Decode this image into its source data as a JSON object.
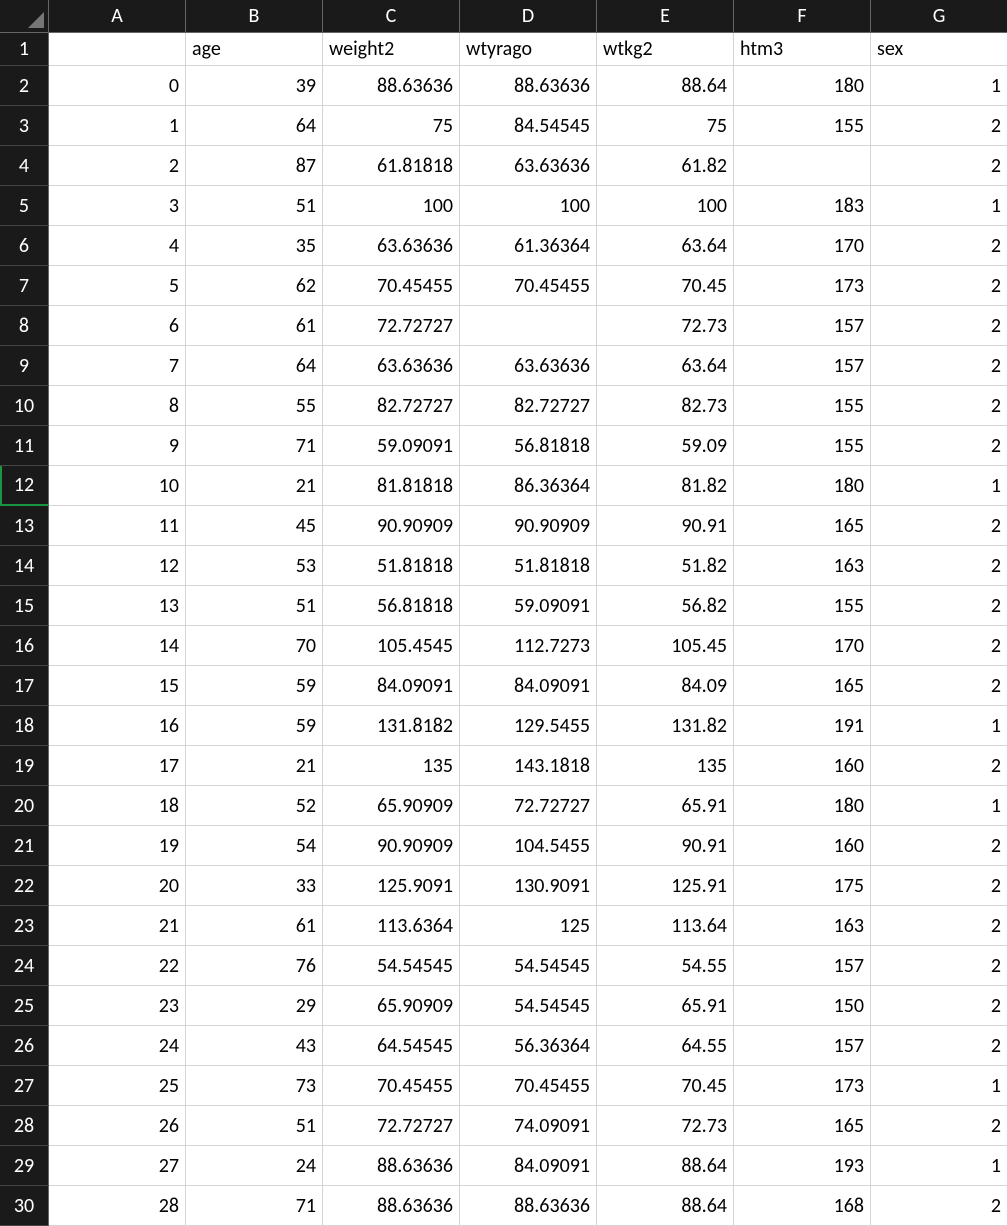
{
  "columns": [
    "A",
    "B",
    "C",
    "D",
    "E",
    "F",
    "G"
  ],
  "headers": [
    "",
    "age",
    "weight2",
    "wtyrago",
    "wtkg2",
    "htm3",
    "sex"
  ],
  "selectedRow": 12,
  "rows": [
    {
      "rn": "1",
      "A": "",
      "B": "age",
      "C": "weight2",
      "D": "wtyrago",
      "E": "wtkg2",
      "F": "htm3",
      "G": "sex",
      "text": true
    },
    {
      "rn": "2",
      "A": "0",
      "B": "39",
      "C": "88.63636",
      "D": "88.63636",
      "E": "88.64",
      "F": "180",
      "G": "1"
    },
    {
      "rn": "3",
      "A": "1",
      "B": "64",
      "C": "75",
      "D": "84.54545",
      "E": "75",
      "F": "155",
      "G": "2"
    },
    {
      "rn": "4",
      "A": "2",
      "B": "87",
      "C": "61.81818",
      "D": "63.63636",
      "E": "61.82",
      "F": "",
      "G": "2"
    },
    {
      "rn": "5",
      "A": "3",
      "B": "51",
      "C": "100",
      "D": "100",
      "E": "100",
      "F": "183",
      "G": "1"
    },
    {
      "rn": "6",
      "A": "4",
      "B": "35",
      "C": "63.63636",
      "D": "61.36364",
      "E": "63.64",
      "F": "170",
      "G": "2"
    },
    {
      "rn": "7",
      "A": "5",
      "B": "62",
      "C": "70.45455",
      "D": "70.45455",
      "E": "70.45",
      "F": "173",
      "G": "2"
    },
    {
      "rn": "8",
      "A": "6",
      "B": "61",
      "C": "72.72727",
      "D": "",
      "E": "72.73",
      "F": "157",
      "G": "2"
    },
    {
      "rn": "9",
      "A": "7",
      "B": "64",
      "C": "63.63636",
      "D": "63.63636",
      "E": "63.64",
      "F": "157",
      "G": "2"
    },
    {
      "rn": "10",
      "A": "8",
      "B": "55",
      "C": "82.72727",
      "D": "82.72727",
      "E": "82.73",
      "F": "155",
      "G": "2"
    },
    {
      "rn": "11",
      "A": "9",
      "B": "71",
      "C": "59.09091",
      "D": "56.81818",
      "E": "59.09",
      "F": "155",
      "G": "2"
    },
    {
      "rn": "12",
      "A": "10",
      "B": "21",
      "C": "81.81818",
      "D": "86.36364",
      "E": "81.82",
      "F": "180",
      "G": "1"
    },
    {
      "rn": "13",
      "A": "11",
      "B": "45",
      "C": "90.90909",
      "D": "90.90909",
      "E": "90.91",
      "F": "165",
      "G": "2"
    },
    {
      "rn": "14",
      "A": "12",
      "B": "53",
      "C": "51.81818",
      "D": "51.81818",
      "E": "51.82",
      "F": "163",
      "G": "2"
    },
    {
      "rn": "15",
      "A": "13",
      "B": "51",
      "C": "56.81818",
      "D": "59.09091",
      "E": "56.82",
      "F": "155",
      "G": "2"
    },
    {
      "rn": "16",
      "A": "14",
      "B": "70",
      "C": "105.4545",
      "D": "112.7273",
      "E": "105.45",
      "F": "170",
      "G": "2"
    },
    {
      "rn": "17",
      "A": "15",
      "B": "59",
      "C": "84.09091",
      "D": "84.09091",
      "E": "84.09",
      "F": "165",
      "G": "2"
    },
    {
      "rn": "18",
      "A": "16",
      "B": "59",
      "C": "131.8182",
      "D": "129.5455",
      "E": "131.82",
      "F": "191",
      "G": "1"
    },
    {
      "rn": "19",
      "A": "17",
      "B": "21",
      "C": "135",
      "D": "143.1818",
      "E": "135",
      "F": "160",
      "G": "2"
    },
    {
      "rn": "20",
      "A": "18",
      "B": "52",
      "C": "65.90909",
      "D": "72.72727",
      "E": "65.91",
      "F": "180",
      "G": "1"
    },
    {
      "rn": "21",
      "A": "19",
      "B": "54",
      "C": "90.90909",
      "D": "104.5455",
      "E": "90.91",
      "F": "160",
      "G": "2"
    },
    {
      "rn": "22",
      "A": "20",
      "B": "33",
      "C": "125.9091",
      "D": "130.9091",
      "E": "125.91",
      "F": "175",
      "G": "2"
    },
    {
      "rn": "23",
      "A": "21",
      "B": "61",
      "C": "113.6364",
      "D": "125",
      "E": "113.64",
      "F": "163",
      "G": "2"
    },
    {
      "rn": "24",
      "A": "22",
      "B": "76",
      "C": "54.54545",
      "D": "54.54545",
      "E": "54.55",
      "F": "157",
      "G": "2"
    },
    {
      "rn": "25",
      "A": "23",
      "B": "29",
      "C": "65.90909",
      "D": "54.54545",
      "E": "65.91",
      "F": "150",
      "G": "2"
    },
    {
      "rn": "26",
      "A": "24",
      "B": "43",
      "C": "64.54545",
      "D": "56.36364",
      "E": "64.55",
      "F": "157",
      "G": "2"
    },
    {
      "rn": "27",
      "A": "25",
      "B": "73",
      "C": "70.45455",
      "D": "70.45455",
      "E": "70.45",
      "F": "173",
      "G": "1"
    },
    {
      "rn": "28",
      "A": "26",
      "B": "51",
      "C": "72.72727",
      "D": "74.09091",
      "E": "72.73",
      "F": "165",
      "G": "2"
    },
    {
      "rn": "29",
      "A": "27",
      "B": "24",
      "C": "88.63636",
      "D": "84.09091",
      "E": "88.64",
      "F": "193",
      "G": "1"
    },
    {
      "rn": "30",
      "A": "28",
      "B": "71",
      "C": "88.63636",
      "D": "88.63636",
      "E": "88.64",
      "F": "168",
      "G": "2"
    }
  ]
}
